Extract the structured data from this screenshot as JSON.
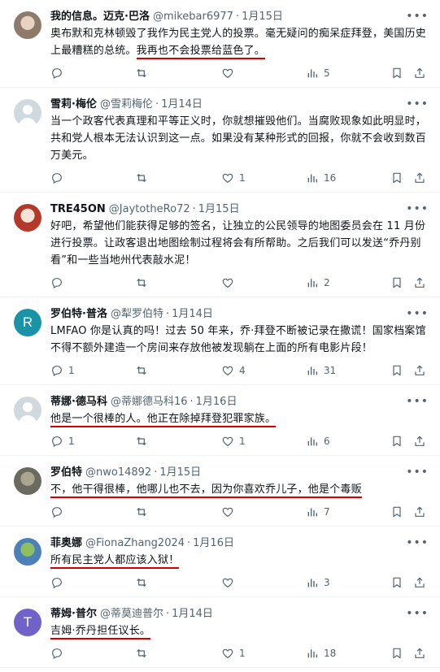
{
  "tweets": [
    {
      "name": "我的信息。迈克·巴洛",
      "handle": "@mikebar6977",
      "time": "1月15日",
      "avatar": {
        "type": "photo",
        "bg": "#8e7a68",
        "fg": "#e8d2c0"
      },
      "text": "奥布默和克林顿毁了我作为民主党人的投票。毫无疑问的痴呆症拜登，美国历史上最糟糕的总统。",
      "underlined": "我再也不会投票给蓝色了。",
      "replies": "",
      "retweets": "",
      "likes": "",
      "views": "5"
    },
    {
      "name": "雪莉·梅伦",
      "handle": "@雪莉梅伦",
      "time": "1月14日",
      "avatar": {
        "type": "default"
      },
      "text": "当一个政客代表真理和平等正义时，你就想摧毁他们。当腐败现象如此明显时，共和党人根本无法认识到这一点。如果没有某种形式的回报，你就不会收到数百万美元。",
      "underlined": "",
      "replies": "",
      "retweets": "",
      "likes": "1",
      "views": "16"
    },
    {
      "name": "TRE45ON",
      "handle": "@JaytotheRo72",
      "time": "1月15日",
      "avatar": {
        "type": "photo",
        "bg": "#b33a2a",
        "fg": "#f3e4d8"
      },
      "text": "好吧，希望他们能获得足够的签名，让独立的公民领导的地图委员会在 11 月份进行投票。让政客退出地图绘制过程将会有所帮助。之后我们可以发送“乔丹别看”和一些当地州代表敲水泥！",
      "underlined": "",
      "replies": "",
      "retweets": "",
      "likes": "",
      "views": "2"
    },
    {
      "name": "罗伯特·普洛",
      "handle": "@犁罗伯特",
      "time": "1月14日",
      "avatar": {
        "type": "letter",
        "letter": "R",
        "bg": "#1a93a6"
      },
      "text": "LMFAO 你是认真的吗！过去 50 年来，乔·拜登不断被记录在撒谎！国家档案馆不得不额外建造一个房间来存放他被发现躺在上面的所有电影片段！",
      "underlined": "",
      "replies": "1",
      "retweets": "",
      "likes": "4",
      "views": "31"
    },
    {
      "name": "蒂娜·德马科",
      "handle": "@蒂娜德马科16",
      "time": "1月16日",
      "avatar": {
        "type": "default"
      },
      "text": "",
      "underlined": "他是一个很棒的人。他正在除掉拜登犯罪家族。",
      "replies": "1",
      "retweets": "",
      "likes": "1",
      "views": "6"
    },
    {
      "name": "罗伯特",
      "handle": "@nwo14892",
      "time": "1月15日",
      "avatar": {
        "type": "photo",
        "bg": "#6b6a5e",
        "fg": "#a9a58f"
      },
      "text": "",
      "underlined": "不，他干得很棒，他哪儿也不去，因为你喜欢乔儿子，他是个毒贩",
      "replies": "",
      "retweets": "",
      "likes": "",
      "views": "7"
    },
    {
      "name": "菲奥娜",
      "handle": "@FionaZhang2024",
      "time": "1月16日",
      "avatar": {
        "type": "photo",
        "bg": "#4d7fb8",
        "fg": "#8cc063"
      },
      "text": "",
      "underlined": "所有民主党人都应该入狱！",
      "replies": "",
      "retweets": "",
      "likes": "",
      "views": "3"
    },
    {
      "name": "蒂姆·普尔",
      "handle": "@蒂莫迪普尔",
      "time": "1月14日",
      "avatar": {
        "type": "letter",
        "letter": "T",
        "bg": "#6f63c9"
      },
      "text": "",
      "underlined": "吉姆·乔丹担任议长。",
      "replies": "",
      "retweets": "",
      "likes": "1",
      "views": "18"
    }
  ]
}
